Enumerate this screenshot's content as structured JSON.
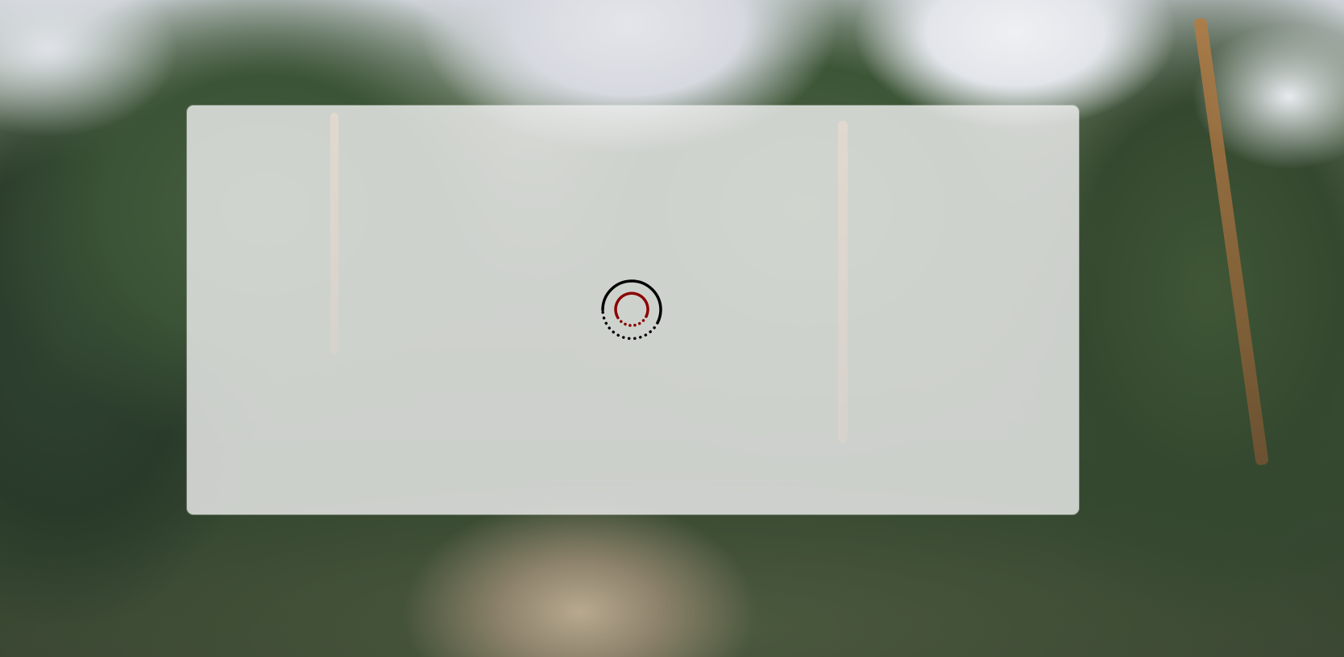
{
  "background": {
    "icon": "forest-photo"
  },
  "overlay": {
    "color": "#eeeeee"
  },
  "spinner": {
    "icon": "loading-spinner-icon",
    "outer_color": "#000000",
    "inner_color": "#8b0000"
  }
}
